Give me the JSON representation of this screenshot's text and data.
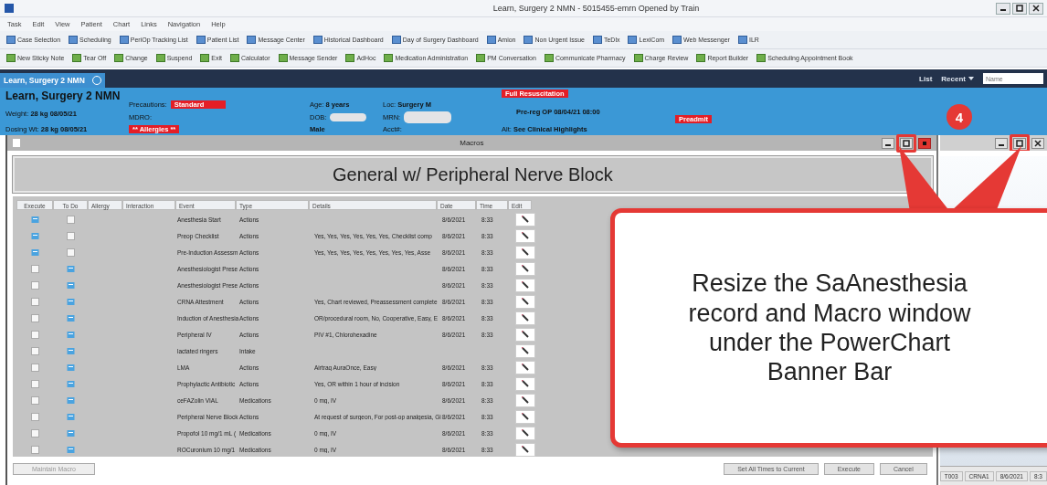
{
  "window": {
    "title": "Learn, Surgery 2 NMN - 5015455-emrn Opened by Train"
  },
  "menu": [
    "Task",
    "Edit",
    "View",
    "Patient",
    "Chart",
    "Links",
    "Navigation",
    "Help"
  ],
  "toolbar_1": [
    "Case Selection",
    "Scheduling",
    "PeriOp Tracking List",
    "Patient List",
    "Message Center",
    "Historical Dashboard",
    "Day of Surgery Dashboard",
    "Amion",
    "Non Urgent Issue",
    "TeDlx",
    "LexiCom",
    "Web Messenger",
    "ILR"
  ],
  "toolbar_2": [
    "New Sticky Note",
    "Tear Off",
    "Change",
    "Suspend",
    "Exit",
    "Calculator",
    "Message Sender",
    "AdHoc",
    "Medication Administration",
    "PM Conversation",
    "Communicate Pharmacy",
    "Charge Review",
    "Report Builder",
    "Scheduling Appointment Book"
  ],
  "patient_tab": {
    "label": "Learn, Surgery 2 NMN"
  },
  "tab_bar": {
    "list": "List",
    "recent": "Recent",
    "search_placeholder": "Name"
  },
  "banner": {
    "name": "Learn, Surgery 2 NMN",
    "weight": {
      "label": "Weight:",
      "value": "28 kg 08/05/21"
    },
    "dosing_weight": {
      "label": "Dosing Wt:",
      "value": "28 kg 08/05/21"
    },
    "precautions": {
      "label": "Precautions:",
      "value": "Standard"
    },
    "mdro": {
      "label": "MDRO:"
    },
    "allergies": "** Allergies **",
    "age": {
      "label": "Age:",
      "value": "8 years"
    },
    "dob": {
      "label": "DOB:"
    },
    "sex": "Male",
    "loc": {
      "label": "Loc:",
      "value": "Surgery M"
    },
    "mrn": {
      "label": "MRN:"
    },
    "acct": {
      "label": "Acct#:"
    },
    "code_status": "Full Resuscitation",
    "encounter": "Pre-reg OP 08/04/21 08:00",
    "alert": {
      "label": "Alt:",
      "value": "See Clinical Highlights"
    },
    "status": "Preadmit"
  },
  "macro_window": {
    "title": "Macros",
    "heading": "General w/ Peripheral Nerve Block",
    "columns": [
      "Execute",
      "To Do",
      "Allergy",
      "Interaction",
      "Event",
      "Type",
      "Details",
      "Date",
      "Time",
      "Edit"
    ],
    "rows": [
      {
        "execute": true,
        "event": "Anesthesia Start",
        "type": "Actions",
        "date": "8/6/2021",
        "time": "8:33"
      },
      {
        "execute": true,
        "event": "Preop Checklist",
        "type": "Actions",
        "details": "Yes, Yes, Yes, Yes, Yes, Yes, Checklist comp",
        "date": "8/6/2021",
        "time": "8:33"
      },
      {
        "execute": true,
        "event": "Pre-Induction Assessm",
        "type": "Actions",
        "details": "Yes, Yes, Yes, Yes, Yes, Yes, Yes, Yes, Asse",
        "date": "8/6/2021",
        "time": "8:33"
      },
      {
        "execute": false,
        "event": "Anesthesiologist Prese",
        "type": "Actions",
        "date": "8/6/2021",
        "time": "8:33"
      },
      {
        "execute": false,
        "event": "Anesthesiologist Prese",
        "type": "Actions",
        "date": "8/6/2021",
        "time": "8:33"
      },
      {
        "execute": false,
        "event": "CRNA Attestment",
        "type": "Actions",
        "details": "Yes, Chart reviewed, Preassessment complete",
        "date": "8/6/2021",
        "time": "8:33"
      },
      {
        "execute": false,
        "event": "Induction of Anesthesia",
        "type": "Actions",
        "details": "OR/procedural room, No, Cooperative, Easy, E",
        "date": "8/6/2021",
        "time": "8:33"
      },
      {
        "execute": false,
        "event": "Peripheral IV",
        "type": "Actions",
        "details": "PIV #1, Chlorohexadine",
        "date": "8/6/2021",
        "time": "8:33"
      },
      {
        "execute": false,
        "event": "lactated ringers",
        "type": "Intake"
      },
      {
        "execute": false,
        "event": "LMA",
        "type": "Actions",
        "details": "Airtraq AuraOnce, Easy",
        "date": "8/6/2021",
        "time": "8:33"
      },
      {
        "execute": false,
        "event": "Prophylactic Antibiotic",
        "type": "Actions",
        "details": "Yes, OR within 1 hour of incision",
        "date": "8/6/2021",
        "time": "8:33"
      },
      {
        "execute": false,
        "event": "ceFAZolin VIAL",
        "type": "Medications",
        "details": "0 mg, IV",
        "date": "8/6/2021",
        "time": "8:33"
      },
      {
        "execute": false,
        "event": "Peripheral Nerve Block",
        "type": "Actions",
        "details": "At request of surgeon, For post-op analgesia, Gi",
        "date": "8/6/2021",
        "time": "8:33"
      },
      {
        "execute": false,
        "event": "Propofol 10 mg/1 mL (",
        "type": "Medications",
        "details": "0 mg, IV",
        "date": "8/6/2021",
        "time": "8:33"
      },
      {
        "execute": false,
        "event": "ROCuronium 10 mg/1",
        "type": "Medications",
        "details": "0 mg, IV",
        "date": "8/6/2021",
        "time": "8:33"
      }
    ],
    "maintain_button": "Maintain Macro",
    "set_times_button": "Set All Times to Current",
    "execute_button": "Execute",
    "cancel_button": "Cancel"
  },
  "side_window": {
    "status": [
      "T003",
      "CRNA1",
      "8/6/2021",
      "8:3"
    ]
  },
  "callout": {
    "step": "4",
    "text": "Resize the SaAnesthesia record and Macro window under the PowerChart Banner Bar"
  }
}
